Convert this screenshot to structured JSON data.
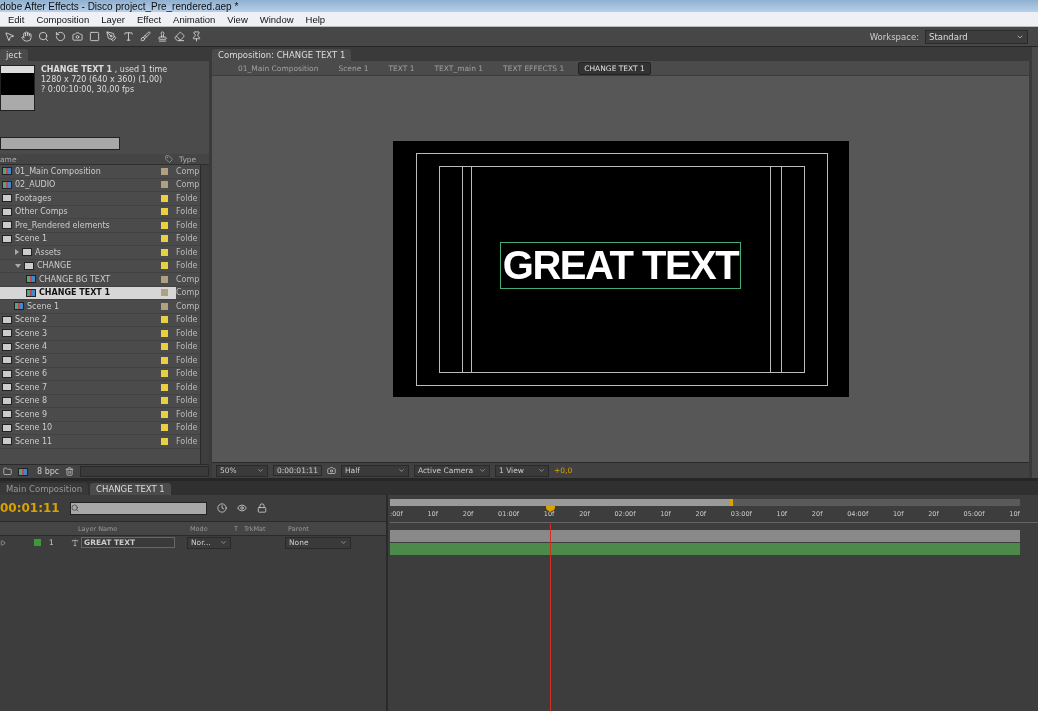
{
  "title_bar": {
    "title": "dobe After Effects - Disco project_Pre_rendered.aep *"
  },
  "menu": [
    "Edit",
    "Composition",
    "Layer",
    "Effect",
    "Animation",
    "View",
    "Window",
    "Help"
  ],
  "toolbar": {
    "workspace_label": "Workspace:",
    "workspace": "Standard"
  },
  "project_panel": {
    "tab": "ject",
    "selected_name": "CHANGE TEXT 1",
    "usage": ", used 1 time",
    "dimensions": "1280 x 720  (640 x 360) (1,00)",
    "duration": "? 0:00:10:00, 30,00 fps",
    "columns": [
      "ame",
      "Type"
    ],
    "bit_depth": "8 bpc",
    "items": [
      {
        "name": "01_Main Composition",
        "kind": "comp",
        "color": "#b0a080",
        "type": "Comp",
        "selected": false
      },
      {
        "name": "02_AUDIO",
        "kind": "comp",
        "color": "#b0a080",
        "type": "Comp",
        "selected": false
      },
      {
        "name": "Footages",
        "kind": "folder",
        "color": "#e8d040",
        "type": "Folde",
        "selected": false
      },
      {
        "name": "Other Comps",
        "kind": "folder",
        "color": "#e8d040",
        "type": "Folde",
        "selected": false
      },
      {
        "name": "Pre_Rendered elements",
        "kind": "folder",
        "color": "#e8d040",
        "type": "Folde",
        "selected": false
      },
      {
        "name": "Scene 1",
        "kind": "folder",
        "color": "#e8d040",
        "type": "Folde",
        "selected": false,
        "children": [
          {
            "name": "Assets",
            "kind": "folder",
            "color": "#e8d040",
            "type": "Folde",
            "selected": false,
            "expanded": false
          },
          {
            "name": "CHANGE",
            "kind": "folder",
            "color": "#e8d040",
            "type": "Folde",
            "selected": false,
            "expanded": true,
            "children": [
              {
                "name": "CHANGE BG TEXT",
                "kind": "comp",
                "color": "#b0a080",
                "type": "Comp",
                "selected": false
              },
              {
                "name": "CHANGE TEXT 1",
                "kind": "comp",
                "color": "#b0a080",
                "type": "Comp",
                "selected": true
              }
            ]
          },
          {
            "name": "Scene 1",
            "kind": "comp",
            "color": "#b0a080",
            "type": "Comp",
            "selected": false
          }
        ]
      },
      {
        "name": "Scene 2",
        "kind": "folder",
        "color": "#e8d040",
        "type": "Folde",
        "selected": false
      },
      {
        "name": "Scene 3",
        "kind": "folder",
        "color": "#e8d040",
        "type": "Folde",
        "selected": false
      },
      {
        "name": "Scene 4",
        "kind": "folder",
        "color": "#e8d040",
        "type": "Folde",
        "selected": false
      },
      {
        "name": "Scene 5",
        "kind": "folder",
        "color": "#e8d040",
        "type": "Folde",
        "selected": false
      },
      {
        "name": "Scene 6",
        "kind": "folder",
        "color": "#e8d040",
        "type": "Folde",
        "selected": false
      },
      {
        "name": "Scene 7",
        "kind": "folder",
        "color": "#e8d040",
        "type": "Folde",
        "selected": false
      },
      {
        "name": "Scene 8",
        "kind": "folder",
        "color": "#e8d040",
        "type": "Folde",
        "selected": false
      },
      {
        "name": "Scene 9",
        "kind": "folder",
        "color": "#e8d040",
        "type": "Folde",
        "selected": false
      },
      {
        "name": "Scene 10",
        "kind": "folder",
        "color": "#e8d040",
        "type": "Folde",
        "selected": false
      },
      {
        "name": "Scene 11",
        "kind": "folder",
        "color": "#e8d040",
        "type": "Folde",
        "selected": false
      }
    ]
  },
  "composition_panel": {
    "tab": "Composition: CHANGE TEXT 1",
    "breadcrumbs": [
      {
        "label": "01_Main Composition",
        "selected": false
      },
      {
        "label": "Scene 1",
        "selected": false
      },
      {
        "label": "TEXT 1",
        "selected": false
      },
      {
        "label": "TEXT_main 1",
        "selected": false
      },
      {
        "label": "TEXT EFFECTS 1",
        "selected": false
      },
      {
        "label": "CHANGE TEXT 1",
        "selected": true
      }
    ],
    "canvas_text": "GREAT TEXT",
    "zoom": "50%",
    "timecode": "0:00:01:11",
    "resolution": "Half",
    "camera": "Active Camera",
    "views": "1 View",
    "exposure": "+0,0"
  },
  "timeline": {
    "tabs": [
      {
        "label": "Main Composition",
        "selected": false
      },
      {
        "label": "CHANGE TEXT 1",
        "selected": true
      }
    ],
    "time": "00:01:11",
    "columns": [
      "Layer Name",
      "Mode",
      "T",
      "TrkMat",
      "Parent"
    ],
    "layers": [
      {
        "number": "1",
        "name": "GREAT TEXT",
        "mode": "Nor...",
        "parent": "None",
        "color": "#3a9a3a"
      }
    ],
    "ruler": [
      ":00f",
      "10f",
      "20f",
      "01:00f",
      "10f",
      "20f",
      "02:00f",
      "10f",
      "20f",
      "03:00f",
      "10f",
      "20f",
      "04:00f",
      "10f",
      "20f",
      "05:00f",
      "10f"
    ],
    "work_area": {
      "level": 0.54
    },
    "playhead": {
      "level": 0.254
    }
  }
}
